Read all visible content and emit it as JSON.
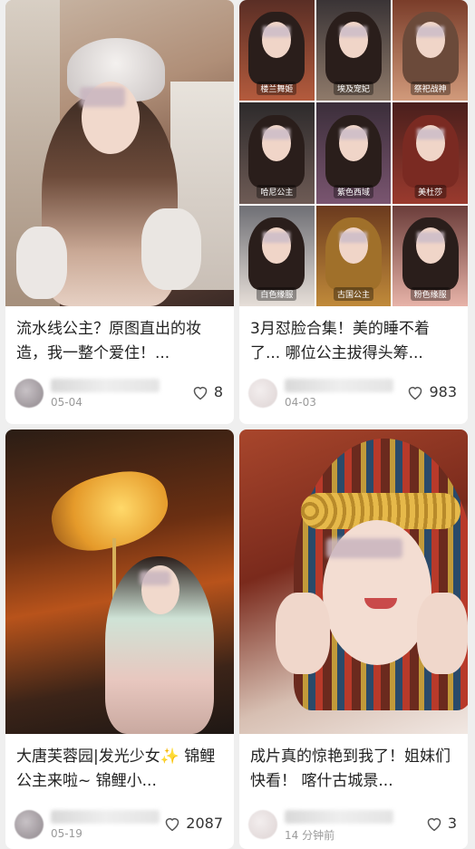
{
  "feed": {
    "cards": [
      {
        "title": "流水线公主？原图直出的妆造，我一整个爱住！...",
        "author": "",
        "date": "05-04",
        "likes": "8"
      },
      {
        "title": "3月怼脸合集！美的睡不着了... 哪位公主拔得头筹...",
        "author": "",
        "date": "04-03",
        "likes": "983",
        "grid_labels": [
          "楼兰舞姬",
          "埃及宠妃",
          "祭祀战神",
          "哈尼公主",
          "紫色西域",
          "美杜莎",
          "白色缘服",
          "古国公主",
          "粉色缘服"
        ]
      },
      {
        "title": "大唐芙蓉园|发光少女✨ 锦鲤公主来啦~ 锦鲤小...",
        "author": "",
        "date": "05-19",
        "likes": "2087"
      },
      {
        "title": "成片真的惊艳到我了！姐妹们快看！ 喀什古城景...",
        "author": "",
        "date": "14 分钟前",
        "likes": "3"
      }
    ]
  },
  "icons": {
    "like": "heart-outline-icon"
  },
  "colors": {
    "background": "#efefef",
    "card": "#ffffff",
    "meta_text": "#9a9a9a"
  }
}
